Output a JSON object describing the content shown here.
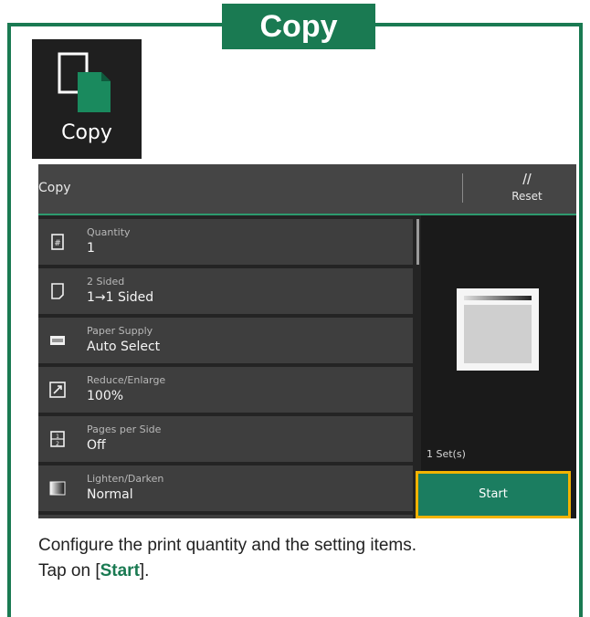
{
  "banner": {
    "title": "Copy"
  },
  "app_tile": {
    "label": "Copy",
    "icon": "copy-icon"
  },
  "screen": {
    "header_title": "Copy",
    "reset_label": "Reset",
    "settings": [
      {
        "label": "Quantity",
        "value": "1",
        "icon": "quantity-icon"
      },
      {
        "label": "2 Sided",
        "value": "1→1 Sided",
        "icon": "two-sided-icon"
      },
      {
        "label": "Paper Supply",
        "value": "Auto Select",
        "icon": "paper-tray-icon"
      },
      {
        "label": "Reduce/Enlarge",
        "value": "100%",
        "icon": "reduce-enlarge-icon"
      },
      {
        "label": "Pages per Side",
        "value": "Off",
        "icon": "pages-per-side-icon"
      },
      {
        "label": "Lighten/Darken",
        "value": "Normal",
        "icon": "lighten-darken-icon"
      }
    ],
    "sets_label": "1 Set(s)",
    "start_label": "Start"
  },
  "instructions": {
    "line1": "Configure the print quantity and the setting items.",
    "line2_prefix": "Tap on [",
    "line2_highlight": "Start",
    "line2_suffix": "]."
  },
  "colors": {
    "brand_green": "#1a7a52",
    "start_green": "#1b7d60",
    "highlight_border": "#f2b300"
  }
}
